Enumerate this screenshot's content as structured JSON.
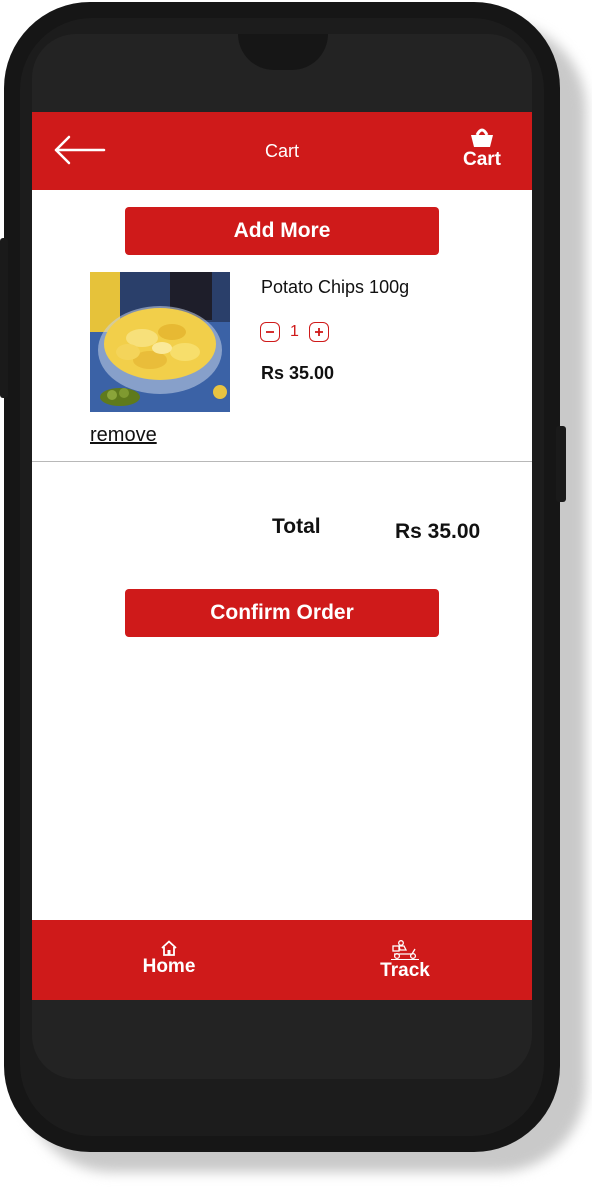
{
  "header": {
    "title": "Cart",
    "cart_label": "Cart"
  },
  "actions": {
    "add_more_label": "Add More",
    "confirm_order_label": "Confirm Order"
  },
  "cart_items": [
    {
      "name": "Potato Chips 100g",
      "quantity": "1",
      "price": "Rs 35.00",
      "remove_label": "remove"
    }
  ],
  "summary": {
    "total_label": "Total",
    "total_value": "Rs 35.00"
  },
  "bottom_nav": [
    {
      "label": "Home",
      "icon": "home-icon"
    },
    {
      "label": "Track",
      "icon": "delivery-scooter-icon"
    }
  ],
  "colors": {
    "brand": "#cf1a1a",
    "device": "#161616"
  }
}
